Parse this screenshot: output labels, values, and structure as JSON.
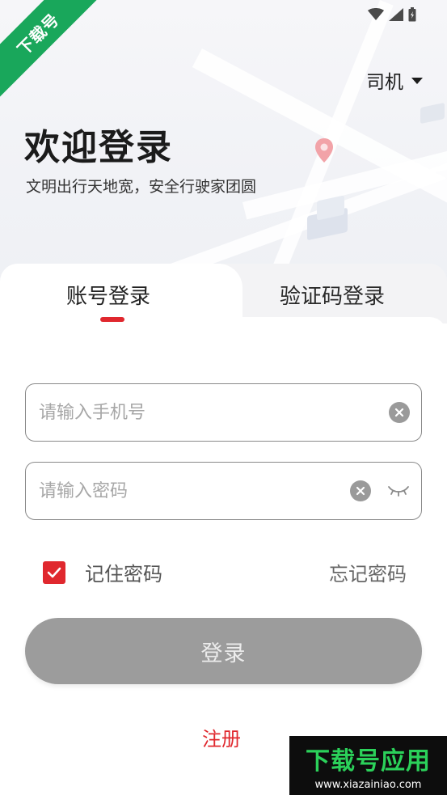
{
  "watermark": {
    "corner_text": "下载号",
    "banner_title": "下载号应用",
    "banner_url": "www.xiazainiao.com"
  },
  "header": {
    "role_selector": "司机",
    "title": "欢迎登录",
    "subtitle": "文明出行天地宽，安全行驶家团圆"
  },
  "tabs": [
    {
      "label": "账号登录",
      "active": true
    },
    {
      "label": "验证码登录",
      "active": false
    }
  ],
  "form": {
    "phone_placeholder": "请输入手机号",
    "password_placeholder": "请输入密码",
    "remember_label": "记住密码",
    "remember_checked": true,
    "forgot_label": "忘记密码",
    "login_label": "登录",
    "register_label": "注册"
  },
  "icons": {
    "status": [
      "wifi-icon",
      "signal-icon",
      "battery-icon"
    ],
    "field": [
      "clear-icon",
      "eye-closed-icon"
    ]
  },
  "colors": {
    "accent": "#e0282e",
    "button_disabled": "#9c9c9c",
    "watermark_green": "#19a75b"
  }
}
